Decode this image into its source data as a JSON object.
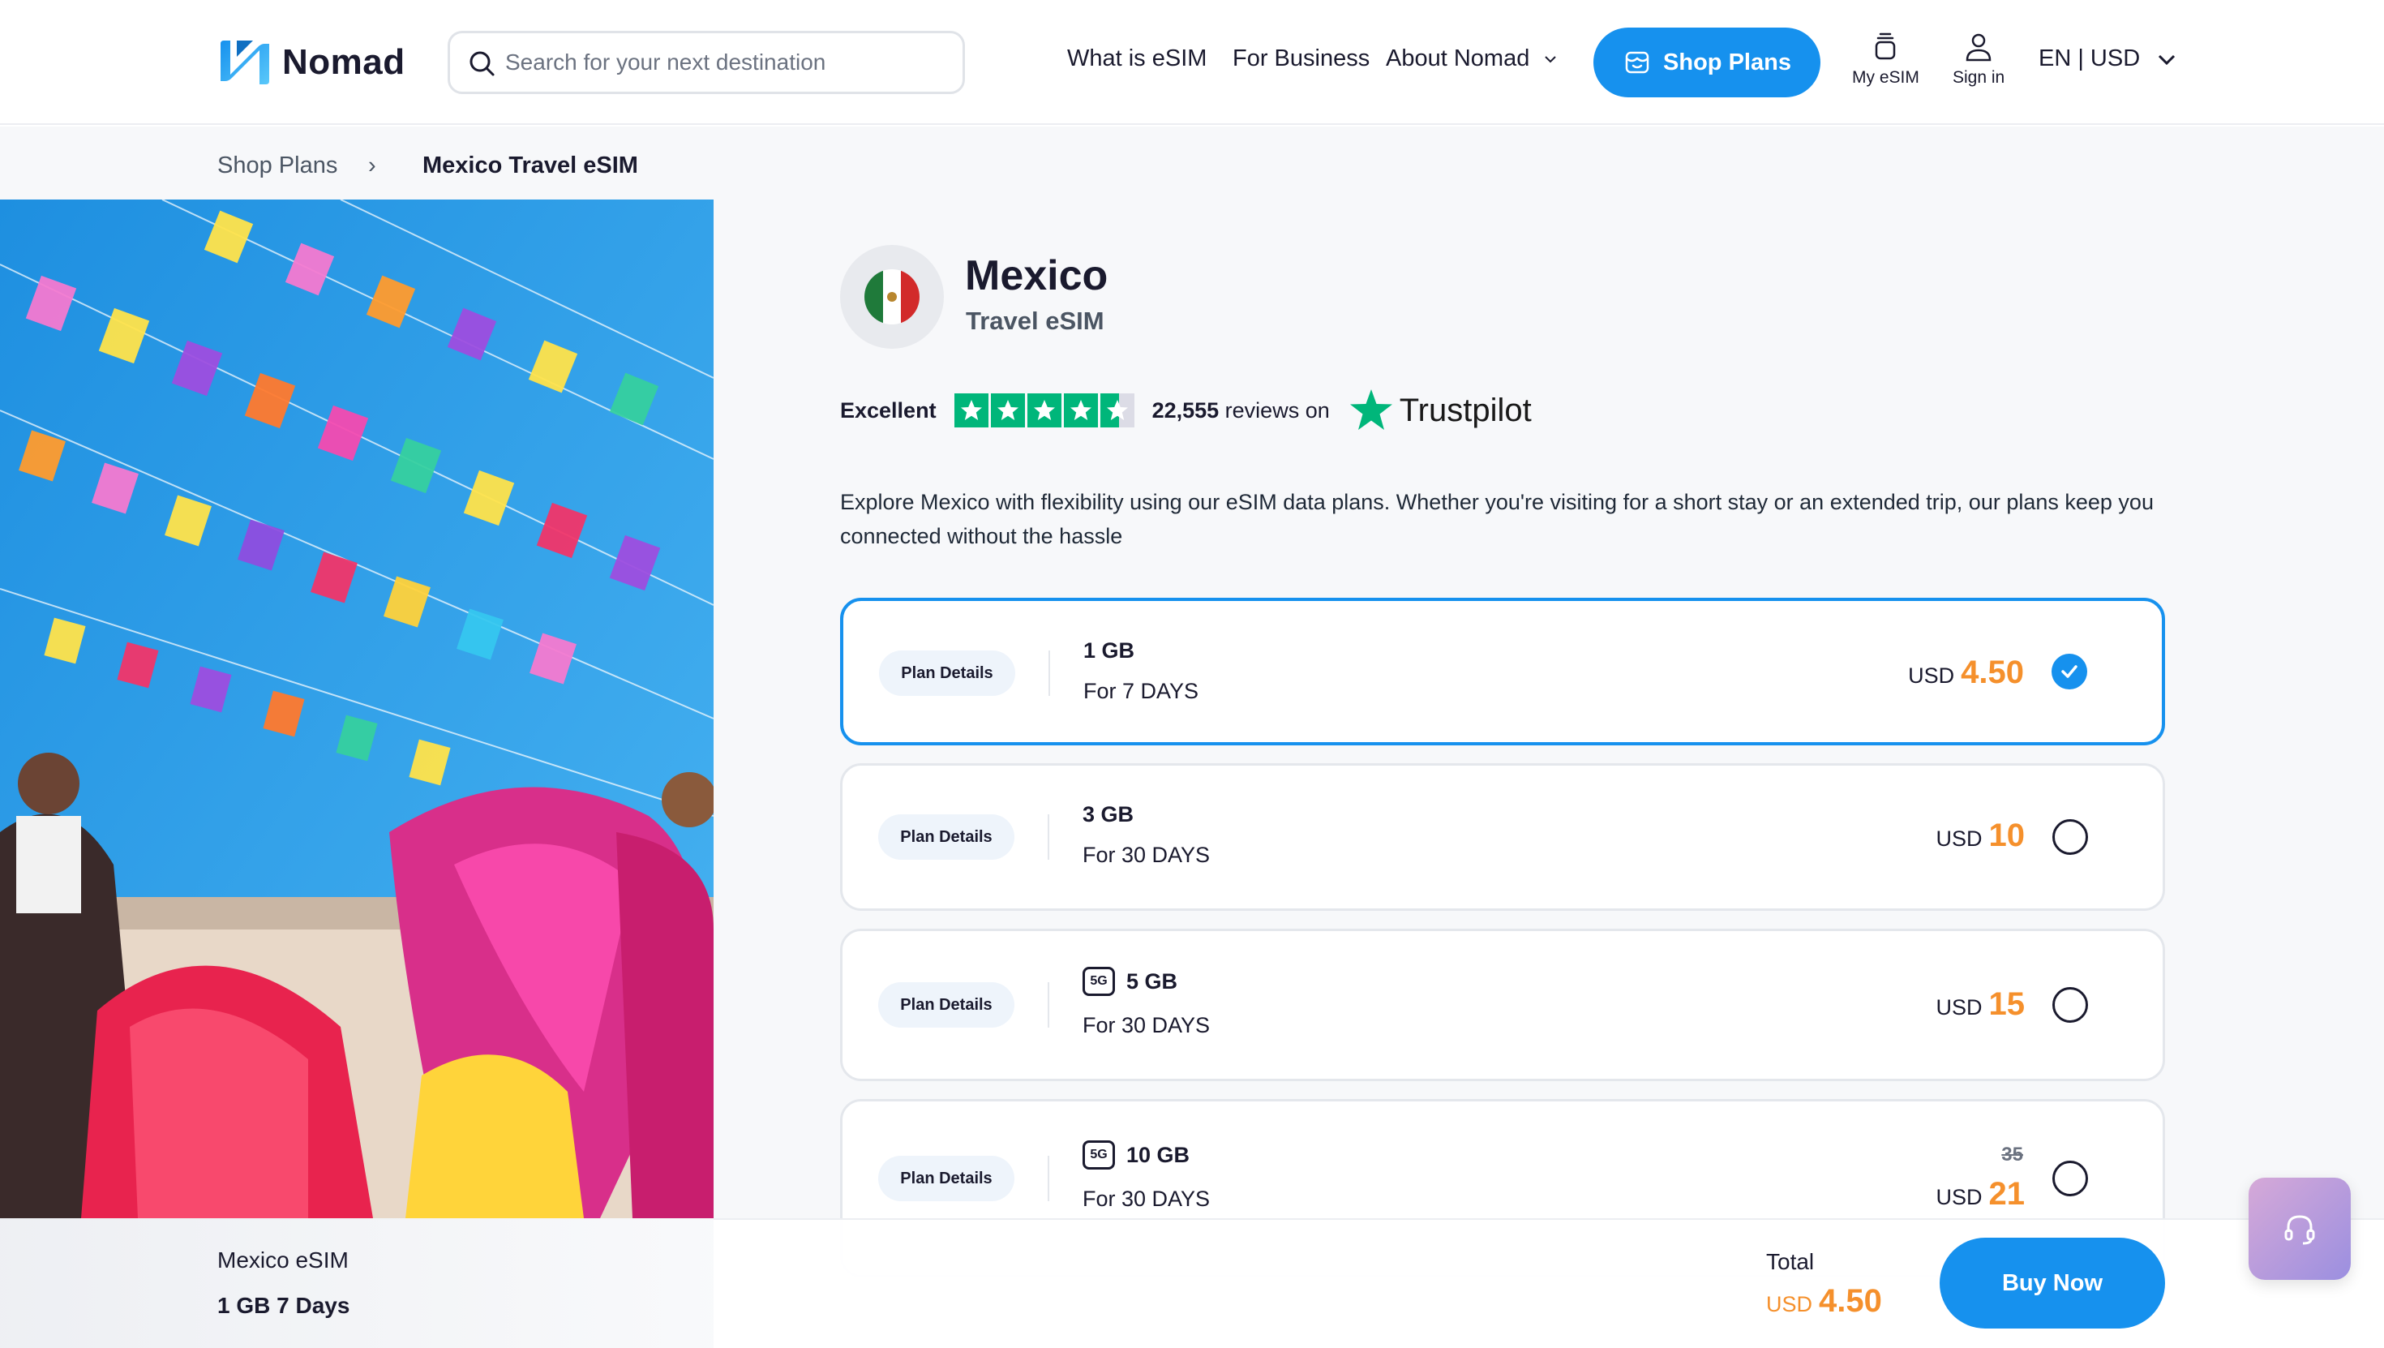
{
  "header": {
    "logo_text": "Nomad",
    "search_placeholder": "Search for your next destination",
    "nav": {
      "what_is_esim": "What is eSIM",
      "for_business": "For Business",
      "about": "About Nomad"
    },
    "shop_plans": "Shop Plans",
    "my_esim": "My eSIM",
    "sign_in": "Sign in",
    "locale": "EN | USD"
  },
  "breadcrumb": {
    "parent": "Shop Plans",
    "separator": "›",
    "current": "Mexico Travel eSIM"
  },
  "product": {
    "country": "Mexico",
    "subtitle": "Travel eSIM",
    "rating_label": "Excellent",
    "review_count": "22,555",
    "review_suffix": "reviews on",
    "review_platform": "Trustpilot",
    "star_rating": 4.5,
    "description": "Explore Mexico with flexibility using our eSIM data plans. Whether you're visiting for a short stay or an extended trip, our plans keep you connected without the hassle"
  },
  "plans": [
    {
      "details_label": "Plan Details",
      "data": "1 GB",
      "days": "For 7 DAYS",
      "currency": "USD",
      "price": "4.50",
      "selected": true
    },
    {
      "details_label": "Plan Details",
      "data": "3 GB",
      "days": "For 30 DAYS",
      "currency": "USD",
      "price": "10",
      "selected": false
    },
    {
      "details_label": "Plan Details",
      "badge": "5G",
      "data": "5 GB",
      "days": "For 30 DAYS",
      "currency": "USD",
      "price": "15",
      "selected": false
    },
    {
      "details_label": "Plan Details",
      "badge": "5G",
      "data": "10 GB",
      "days": "For 30 DAYS",
      "currency": "USD",
      "old_price": "35",
      "price": "21",
      "selected": false
    }
  ],
  "summary": {
    "title": "Mexico eSIM",
    "plan": "1 GB 7 Days",
    "total_label": "Total",
    "total_currency": "USD",
    "total_value": "4.50",
    "buy_label": "Buy Now"
  },
  "colors": {
    "primary": "#1691ee",
    "price_orange": "#f5902c",
    "trustpilot_green": "#00b67a",
    "text_dark": "#1a1a2e"
  },
  "icons": {
    "search": "search-icon",
    "shop": "store-icon",
    "my_esim": "esim-stack-icon",
    "sign_in": "user-icon",
    "support": "headset-icon"
  }
}
